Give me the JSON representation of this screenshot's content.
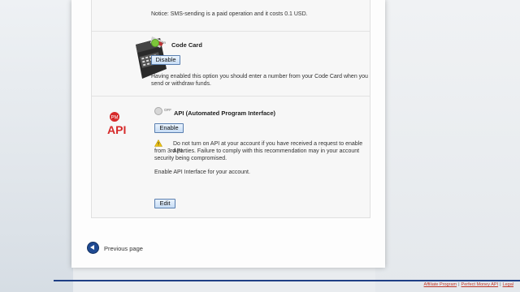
{
  "sms_notice": "Notice: SMS-sending is a paid operation and it costs 0.1 USD.",
  "code_card": {
    "status": "on",
    "title": "Code Card",
    "button": "Disable",
    "description_line1": "Having enabled this option you should enter a number from your Code Card when you",
    "description_line2": "send or withdraw funds."
  },
  "api": {
    "logo_pm": "PM",
    "logo_text": "API",
    "status": "OFF",
    "title": "API (Automated Program Interface)",
    "button": "Enable",
    "warning_line1": "Do not turn on API at your account if you have received a request to enable API",
    "warning_line2": "from 3rd parties. Failure to comply with this recommendation may in your account",
    "warning_line3": "security being compromised.",
    "enable_text": "Enable API Interface for your account.",
    "edit_button": "Edit"
  },
  "previous_page": "Previous page",
  "footer": {
    "links": [
      "Affiliate Program",
      "Perfect Money API",
      "Legal"
    ]
  }
}
